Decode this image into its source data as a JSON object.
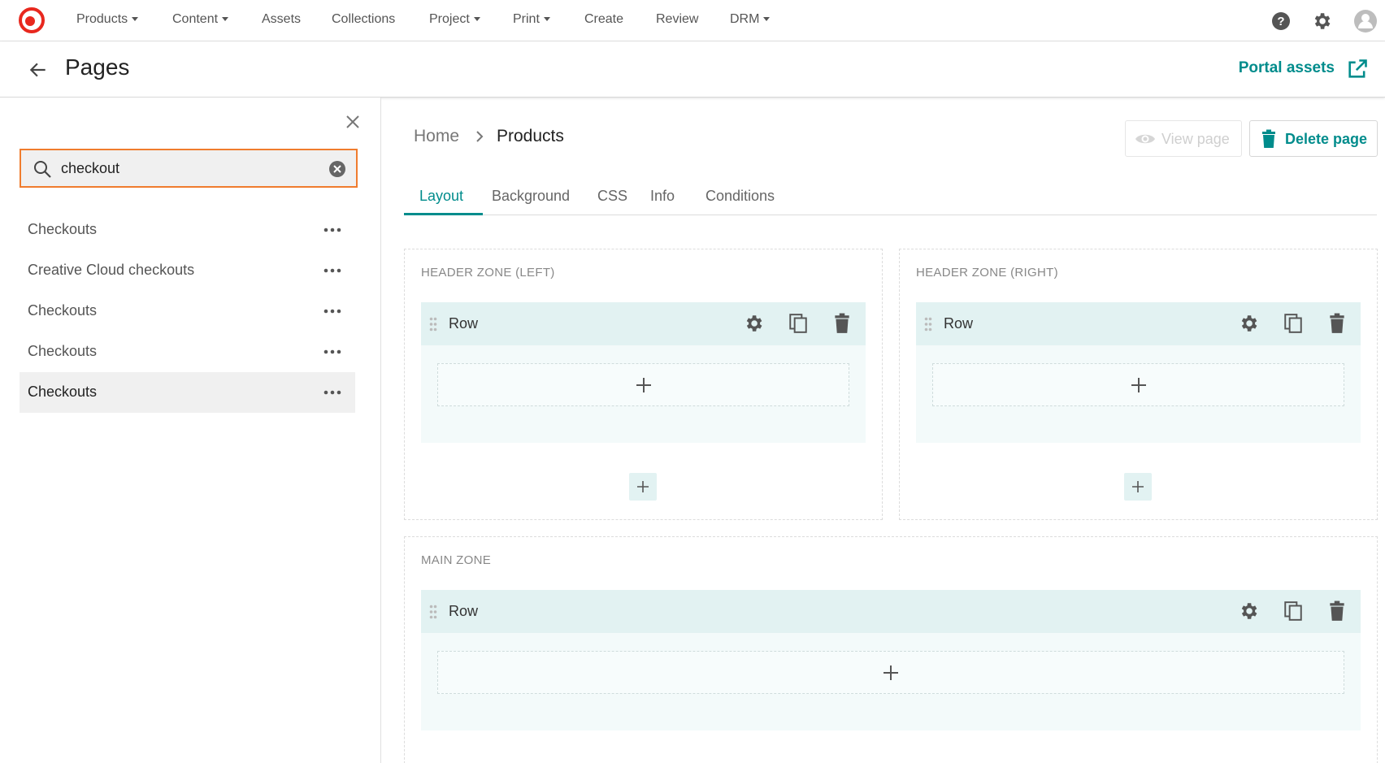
{
  "nav": {
    "items": [
      {
        "label": "Products",
        "dropdown": true
      },
      {
        "label": "Content",
        "dropdown": true
      },
      {
        "label": "Assets",
        "dropdown": false
      },
      {
        "label": "Collections",
        "dropdown": false
      },
      {
        "label": "Project",
        "dropdown": true
      },
      {
        "label": "Print",
        "dropdown": true
      },
      {
        "label": "Create",
        "dropdown": false
      },
      {
        "label": "Review",
        "dropdown": false
      },
      {
        "label": "DRM",
        "dropdown": true
      }
    ],
    "icons": [
      "help-icon",
      "gear-icon",
      "user-avatar-icon"
    ]
  },
  "header": {
    "title": "Pages",
    "portal_link": "Portal assets"
  },
  "sidebar": {
    "search": {
      "value": "checkout",
      "placeholder": ""
    },
    "pages": [
      {
        "label": "Checkouts",
        "active": false
      },
      {
        "label": "Creative Cloud checkouts",
        "active": false
      },
      {
        "label": "Checkouts",
        "active": false
      },
      {
        "label": "Checkouts",
        "active": false
      },
      {
        "label": "Checkouts",
        "active": true
      }
    ]
  },
  "main": {
    "breadcrumb": {
      "home": "Home",
      "current": "Products"
    },
    "view_button": "View page",
    "delete_button": "Delete page",
    "tabs": [
      {
        "label": "Layout",
        "active": true
      },
      {
        "label": "Background",
        "active": false
      },
      {
        "label": "CSS",
        "active": false
      },
      {
        "label": "Info",
        "active": false
      },
      {
        "label": "Conditions",
        "active": false
      }
    ],
    "zones": [
      {
        "title": "HEADER ZONE (LEFT)",
        "row_label": "Row"
      },
      {
        "title": "HEADER ZONE (RIGHT)",
        "row_label": "Row"
      },
      {
        "title": "MAIN ZONE",
        "row_label": "Row"
      }
    ]
  },
  "colors": {
    "accent": "#008c8c",
    "search_border": "#f07c2e",
    "row_bar": "#e2f2f2",
    "logo": "#e8281e"
  }
}
